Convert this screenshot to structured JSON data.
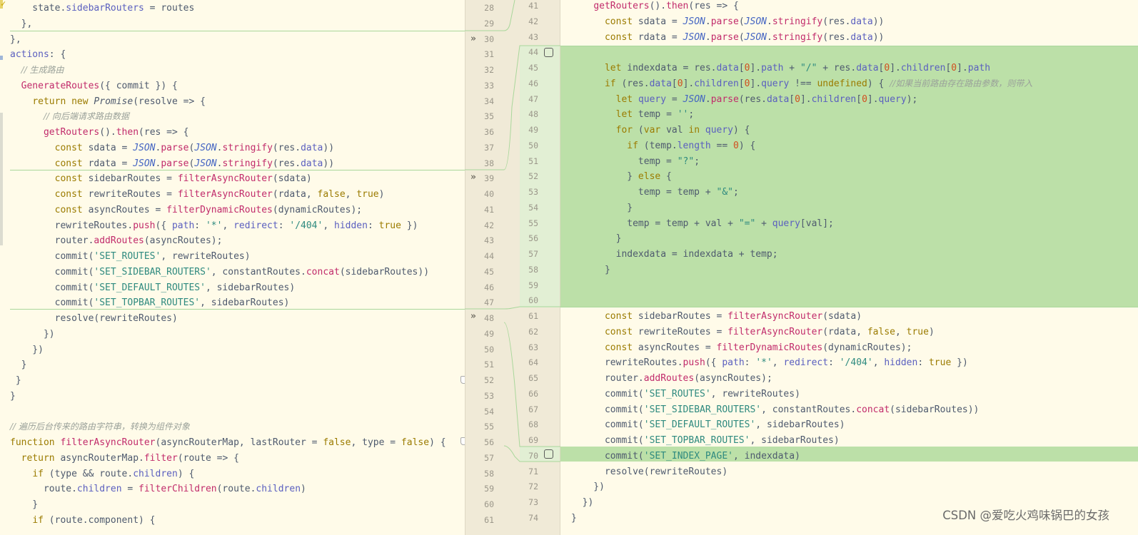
{
  "left_code": [
    "    state.sidebarRouters = routes",
    "  },",
    "},",
    "actions: {",
    "  // 生成路由",
    "  GenerateRoutes({ commit }) {",
    "    return new Promise(resolve => {",
    "      // 向后端请求路由数据",
    "      getRouters().then(res => {",
    "        const sdata = JSON.parse(JSON.stringify(res.data))",
    "        const rdata = JSON.parse(JSON.stringify(res.data))",
    "        const sidebarRoutes = filterAsyncRouter(sdata)",
    "        const rewriteRoutes = filterAsyncRouter(rdata, false, true)",
    "        const asyncRoutes = filterDynamicRoutes(dynamicRoutes);",
    "        rewriteRoutes.push({ path: '*', redirect: '/404', hidden: true })",
    "        router.addRoutes(asyncRoutes);",
    "        commit('SET_ROUTES', rewriteRoutes)",
    "        commit('SET_SIDEBAR_ROUTERS', constantRoutes.concat(sidebarRoutes))",
    "        commit('SET_DEFAULT_ROUTES', sidebarRoutes)",
    "        commit('SET_TOPBAR_ROUTES', sidebarRoutes)",
    "        resolve(rewriteRoutes)",
    "      })",
    "    })",
    "  }",
    " }",
    "}",
    "",
    "// 遍历后台传来的路由字符串，转换为组件对象",
    "function filterAsyncRouter(asyncRouterMap, lastRouter = false, type = false) {",
    "  return asyncRouterMap.filter(route => {",
    "    if (type && route.children) {",
    "      route.children = filterChildren(route.children)",
    "    }",
    "    if (route.component) {"
  ],
  "left_line_numbers": [
    "28",
    "29",
    "30",
    "31",
    "32",
    "33",
    "34",
    "35",
    "36",
    "37",
    "38",
    "39",
    "40",
    "41",
    "42",
    "43",
    "44",
    "45",
    "46",
    "47",
    "48",
    "49",
    "50",
    "51",
    "52",
    "53",
    "54",
    "55",
    "56",
    "57",
    "58",
    "59",
    "60",
    "61"
  ],
  "right_line_numbers": [
    "41",
    "42",
    "43",
    "44",
    "45",
    "46",
    "47",
    "48",
    "49",
    "50",
    "51",
    "52",
    "53",
    "54",
    "55",
    "56",
    "57",
    "58",
    "59",
    "60",
    "61",
    "62",
    "63",
    "64",
    "65",
    "66",
    "67",
    "68",
    "69",
    "70",
    "71",
    "72",
    "73",
    "74"
  ],
  "right_code": [
    "    getRouters().then(res => {",
    "      const sdata = JSON.parse(JSON.stringify(res.data))",
    "      const rdata = JSON.parse(JSON.stringify(res.data))",
    "",
    "      let indexdata = res.data[0].path + \"/\" + res.data[0].children[0].path",
    "      if (res.data[0].children[0].query !== undefined) { //如果当前路由存在路由参数，则带入",
    "        let query = JSON.parse(res.data[0].children[0].query);",
    "        let temp = '';",
    "        for (var val in query) {",
    "          if (temp.length == 0) {",
    "            temp = \"?\";",
    "          } else {",
    "            temp = temp + \"&\";",
    "          }",
    "          temp = temp + val + \"=\" + query[val];",
    "        }",
    "        indexdata = indexdata + temp;",
    "      }",
    "",
    "",
    "      const sidebarRoutes = filterAsyncRouter(sdata)",
    "      const rewriteRoutes = filterAsyncRouter(rdata, false, true)",
    "      const asyncRoutes = filterDynamicRoutes(dynamicRoutes);",
    "      rewriteRoutes.push({ path: '*', redirect: '/404', hidden: true })",
    "      router.addRoutes(asyncRoutes);",
    "      commit('SET_ROUTES', rewriteRoutes)",
    "      commit('SET_SIDEBAR_ROUTERS', constantRoutes.concat(sidebarRoutes))",
    "      commit('SET_DEFAULT_ROUTES', sidebarRoutes)",
    "      commit('SET_TOPBAR_ROUTES', sidebarRoutes)",
    "      commit('SET_INDEX_PAGE', indexdata)",
    "      resolve(rewriteRoutes)",
    "    })",
    "  })",
    "}"
  ],
  "watermark": "CSDN @爱吃火鸡味锅巴的女孩",
  "colors": {
    "added": "#bce0a8",
    "background": "#fffbe9",
    "gutter": "#f0ead7"
  },
  "icons": [
    "merge-chevron-icon",
    "include-checkbox-icon",
    "fold-marker-icon",
    "checkmark-icon"
  ]
}
